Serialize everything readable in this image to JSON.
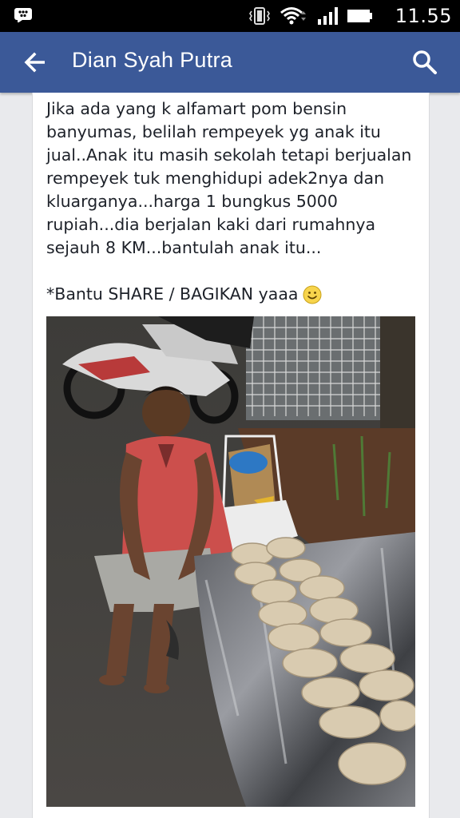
{
  "status_bar": {
    "time": "11.55",
    "icons": [
      "bbm-icon",
      "vibrate-icon",
      "wifi-icon",
      "signal-icon",
      "battery-icon"
    ]
  },
  "app_bar": {
    "title": "Dian Syah Putra",
    "back_icon": "arrow-left-icon",
    "search_icon": "search-icon",
    "color": "#3b5998"
  },
  "post": {
    "body": "Jika ada yang k alfamart pom bensin banyumas, belilah rempeyek yg anak itu jual..Anak itu masih sekolah tetapi berjualan rempeyek tuk menghidupi adek2nya dan kluarganya...harga 1 bungkus 5000 rupiah...dia berjalan kaki dari rumahnya sejauh 8 KM...bantulah anak itu...",
    "share": "*Bantu SHARE / BAGIKAN yaaa",
    "emoji": "smiley-icon"
  }
}
